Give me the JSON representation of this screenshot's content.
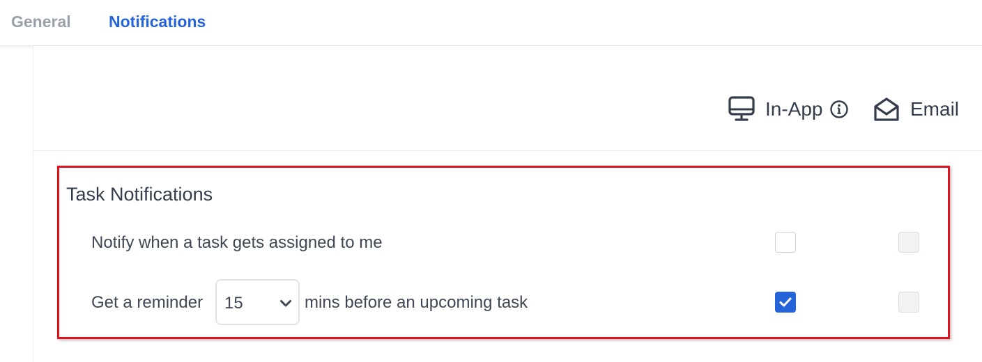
{
  "tabs": {
    "general": "General",
    "notifications": "Notifications"
  },
  "columns": {
    "in_app": "In-App",
    "email": "Email"
  },
  "section": {
    "title": "Task Notifications"
  },
  "rows": [
    {
      "label": "Notify when a task gets assigned to me",
      "in_app_checked": false,
      "email_checked": false,
      "email_disabled": true
    },
    {
      "label_before": "Get a reminder",
      "select_value": "15",
      "label_after": "mins before an upcoming task",
      "in_app_checked": true,
      "email_checked": false,
      "email_disabled": true
    }
  ],
  "icons": {
    "in_app": "monitor-icon",
    "in_app_info": "info-icon",
    "email": "envelope-open-icon",
    "select": "chevron-down-icon"
  },
  "colors": {
    "accent": "#2563d8",
    "highlight_border": "#e0121e",
    "inactive_tab": "#9aa0a9"
  }
}
